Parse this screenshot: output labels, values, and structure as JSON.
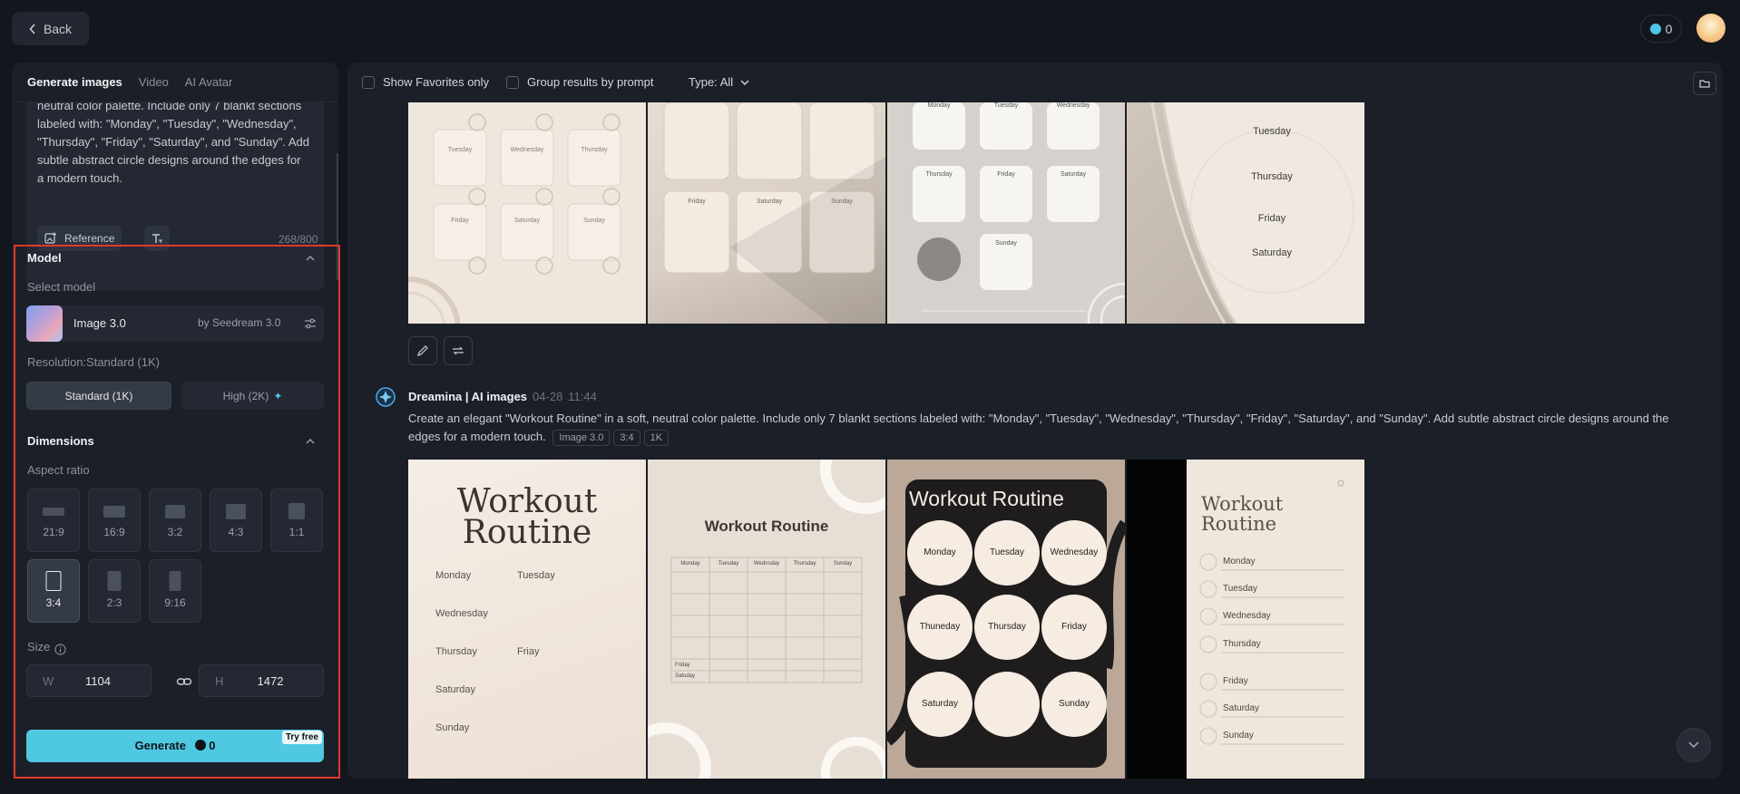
{
  "topbar": {
    "back_label": "Back",
    "credits": "0"
  },
  "sidebar": {
    "tabs": [
      "Generate images",
      "Video",
      "AI Avatar"
    ],
    "prompt_text": "neutral color palette. Include only 7 blankt sections labeled with: \"Monday\", \"Tuesday\", \"Wednesday\", \"Thursday\", \"Friday\", \"Saturday\", and \"Sunday\". Add subtle abstract circle designs around the edges for a modern touch.",
    "reference_label": "Reference",
    "char_count": "268/800",
    "model_title": "Model",
    "select_model_label": "Select model",
    "model_name": "Image 3.0",
    "model_by": "by Seedream 3.0",
    "resolution_label": "Resolution:Standard (1K)",
    "res_standard": "Standard (1K)",
    "res_high": "High (2K)",
    "dimensions_title": "Dimensions",
    "aspect_label": "Aspect ratio",
    "aspect_ratios": [
      "21:9",
      "16:9",
      "3:2",
      "4:3",
      "1:1",
      "3:4",
      "2:3",
      "9:16"
    ],
    "selected_ratio": "3:4",
    "size_label": "Size",
    "width_key": "W",
    "width_value": "1104",
    "height_key": "H",
    "height_value": "1472",
    "generate_label": "Generate",
    "generate_cost": "0",
    "try_free": "Try free"
  },
  "main": {
    "show_favorites": "Show Favorites only",
    "group_results": "Group results by prompt",
    "type_filter": "Type: All",
    "row1": {
      "tile1": {
        "labels": [
          "Tuesday",
          "Wednesday",
          "Thursday",
          "Friday",
          "Saturday",
          "Sunday"
        ]
      },
      "tile2": {
        "labels": [
          "Friday",
          "Saturday",
          "Sunday"
        ]
      },
      "tile3": {
        "labels": [
          "Monday",
          "Tuesday",
          "Wednesday",
          "Thursday",
          "Friday",
          "Saturday",
          "Sunday"
        ]
      },
      "tile4": {
        "labels": [
          "Tuesday",
          "Thursday",
          "Friday",
          "Saturday"
        ]
      }
    },
    "generation": {
      "author": "Dreamina | AI images",
      "date": "04-28",
      "time": "11:44",
      "prompt": "Create an elegant \"Workout Routine\" in a soft, neutral color palette. Include only 7 blankt sections labeled with: \"Monday\", \"Tuesday\", \"Wednesday\", \"Thursday\", \"Friday\", \"Saturday\", and \"Sunday\". Add subtle abstract circle designs around the edges for a modern touch.",
      "tags": [
        "Image 3.0",
        "3:4",
        "1K"
      ]
    },
    "row2": {
      "tile1": {
        "title_line1": "Workout",
        "title_line2": "Routine",
        "days": [
          "Monday",
          "Tuesday",
          "Wednesday",
          "Thursday",
          "Friay",
          "Saturday",
          "Sunday"
        ]
      },
      "tile2": {
        "title": "Workout Routine",
        "cols": [
          "Monday",
          "Tuesday",
          "Wednsday",
          "Thursday",
          "Sunday"
        ],
        "rows": [
          "Friday",
          "Satuday"
        ]
      },
      "tile3": {
        "title": "Workout Routine",
        "days": [
          "Monday",
          "Tuesday",
          "Wednesday",
          "Thuneday",
          "Thursday",
          "Friday",
          "Saturday",
          "",
          "Sunday"
        ]
      },
      "tile4": {
        "title_line1": "Workout",
        "title_line2": "Routine",
        "days": [
          "Monday",
          "Tuesday",
          "Wednesday",
          "Thursday",
          "Friday",
          "Saturday",
          "Sunday"
        ]
      }
    }
  },
  "colors": {
    "accent": "#4fc8e2",
    "highlight": "#e0392b",
    "background": "#13161c",
    "panel": "#1b1f27"
  }
}
